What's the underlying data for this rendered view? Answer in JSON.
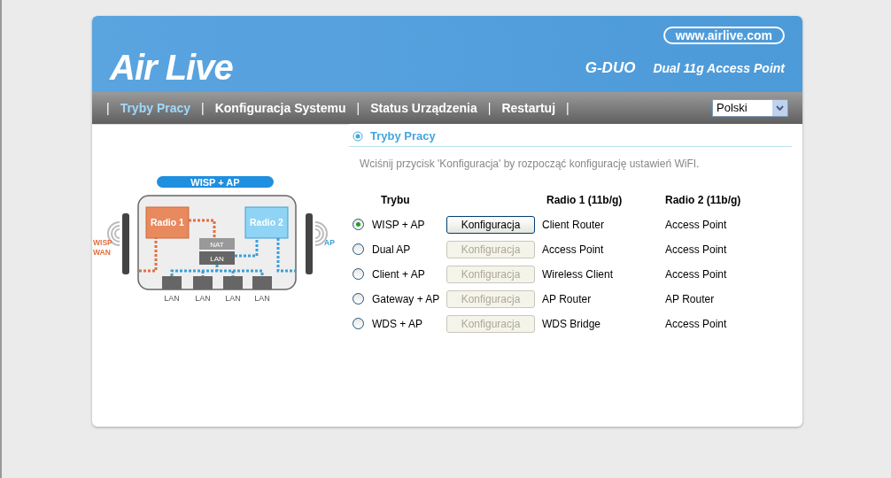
{
  "header": {
    "logo": "Air Live",
    "website": "www.airlive.com",
    "model": "G-DUO",
    "product": "Dual 11g Access Point"
  },
  "nav": {
    "items": [
      {
        "label": "Tryby Pracy",
        "selected": true
      },
      {
        "label": "Konfiguracja Systemu",
        "selected": false
      },
      {
        "label": "Status Urządzenia",
        "selected": false
      },
      {
        "label": "Restartuj",
        "selected": false
      }
    ],
    "separator": "|",
    "language": "Polski"
  },
  "diagram": {
    "mode": "WISP + AP",
    "radio1": "Radio 1",
    "radio2": "Radio 2",
    "nat": "NAT",
    "lan": "LAN",
    "ports": [
      "LAN",
      "LAN",
      "LAN",
      "LAN"
    ],
    "left_labels": [
      "WISP",
      "WAN"
    ],
    "right_label": "AP"
  },
  "section": {
    "title": "Tryby Pracy",
    "hint": "Wciśnij przycisk 'Konfiguracja' by rozpocząć konfigurację ustawień WiFI."
  },
  "table": {
    "columns": [
      "Trybu",
      "Radio 1 (11b/g)",
      "Radio 2 (11b/g)"
    ],
    "rows": [
      {
        "mode": "WISP + AP",
        "button": "Konfiguracja",
        "radio1": "Client Router",
        "radio2": "Access Point",
        "selected": true
      },
      {
        "mode": "Dual AP",
        "button": "Konfiguracja",
        "radio1": "Access Point",
        "radio2": "Access Point",
        "selected": false
      },
      {
        "mode": "Client + AP",
        "button": "Konfiguracja",
        "radio1": "Wireless Client",
        "radio2": "Access Point",
        "selected": false
      },
      {
        "mode": "Gateway + AP",
        "button": "Konfiguracja",
        "radio1": "AP Router",
        "radio2": "AP Router",
        "selected": false
      },
      {
        "mode": "WDS + AP",
        "button": "Konfiguracja",
        "radio1": "WDS Bridge",
        "radio2": "Access Point",
        "selected": false
      }
    ]
  }
}
